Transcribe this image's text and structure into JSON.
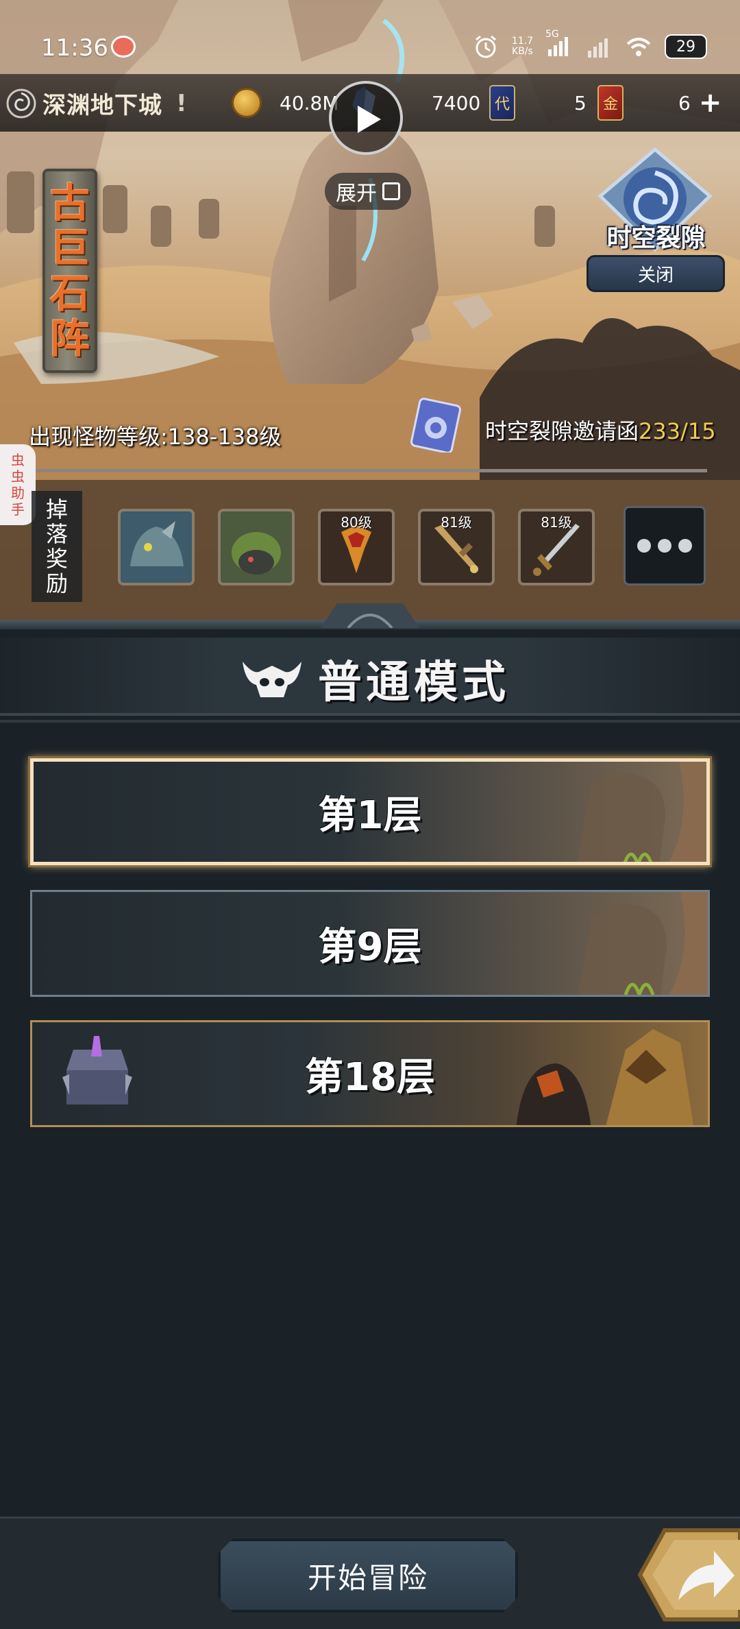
{
  "status_bar": {
    "time": "11:36",
    "net_speed": "11.7",
    "net_speed_unit": "KB/s",
    "network_type": "5G",
    "battery": "29"
  },
  "resource_bar": {
    "dungeon_name": "深渊地下城",
    "alert": "!",
    "gold": "40.8M",
    "crystals": "7400",
    "tickets_a": "5",
    "card_glyph_a": "代",
    "tickets_b": "6",
    "card_glyph_b": "金"
  },
  "hero": {
    "expand_label": "展开",
    "zone_name": [
      "古",
      "巨",
      "石",
      "阵"
    ],
    "rift_label": "时空裂隙",
    "rift_close_label": "关闭",
    "monster_level": "出现怪物等级:138-138级",
    "invite_label": "时空裂隙邀请函",
    "invite_count": "233/15"
  },
  "helper_tab": [
    "虫",
    "虫",
    "助",
    "手"
  ],
  "drops": {
    "label": [
      "掉",
      "落",
      "奖",
      "励"
    ],
    "items": [
      {
        "name": "armored-dragon",
        "level": ""
      },
      {
        "name": "moss-golem",
        "level": ""
      },
      {
        "name": "flame-axe",
        "level": "80级"
      },
      {
        "name": "golden-sword",
        "level": "81级"
      },
      {
        "name": "steel-greatsword",
        "level": "81级"
      }
    ]
  },
  "mode": {
    "title": "普通模式"
  },
  "floors": [
    {
      "label": "第1层",
      "selected": true
    },
    {
      "label": "第9层",
      "selected": false
    },
    {
      "label": "第18层",
      "selected": false,
      "boss": true
    }
  ],
  "bottom": {
    "start_label": "开始冒险"
  },
  "colors": {
    "panel_bg": "#1b2227",
    "accent_gold": "#f2cc4d",
    "zone_orange": "#e8702b",
    "selected_border": "#f3e1bf"
  }
}
